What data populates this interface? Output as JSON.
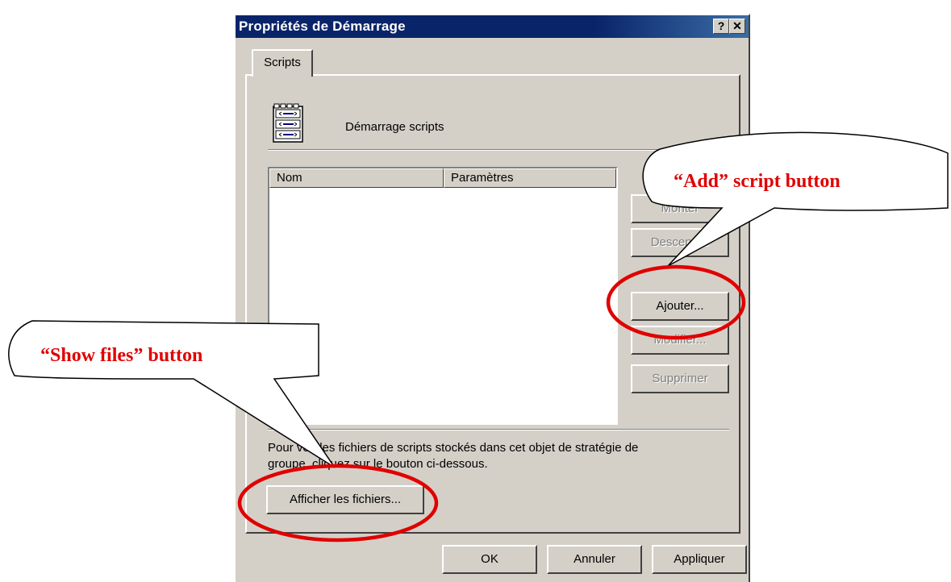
{
  "window": {
    "title": "Propriétés de Démarrage",
    "help_button": "?",
    "close_button": "✕"
  },
  "tabs": [
    {
      "label": "Scripts"
    }
  ],
  "scripts_panel": {
    "heading": "Démarrage scripts",
    "icon": "script-document-icon",
    "list": {
      "columns": [
        "Nom",
        "Paramètres"
      ],
      "rows": []
    },
    "buttons": {
      "up": "Monter",
      "down": "Descendre",
      "add": "Ajouter...",
      "edit": "Modifier...",
      "remove": "Supprimer"
    },
    "info_text": "Pour voir les fichiers de scripts stockés dans cet objet de stratégie de groupe, cliquez sur le bouton ci-dessous.",
    "show_files_button": "Afficher les fichiers..."
  },
  "footer": {
    "ok": "OK",
    "cancel": "Annuler",
    "apply": "Appliquer"
  },
  "annotations": {
    "add_callout": "“Add” script button",
    "show_files_callout": "“Show files” button",
    "color": "#e00000"
  }
}
